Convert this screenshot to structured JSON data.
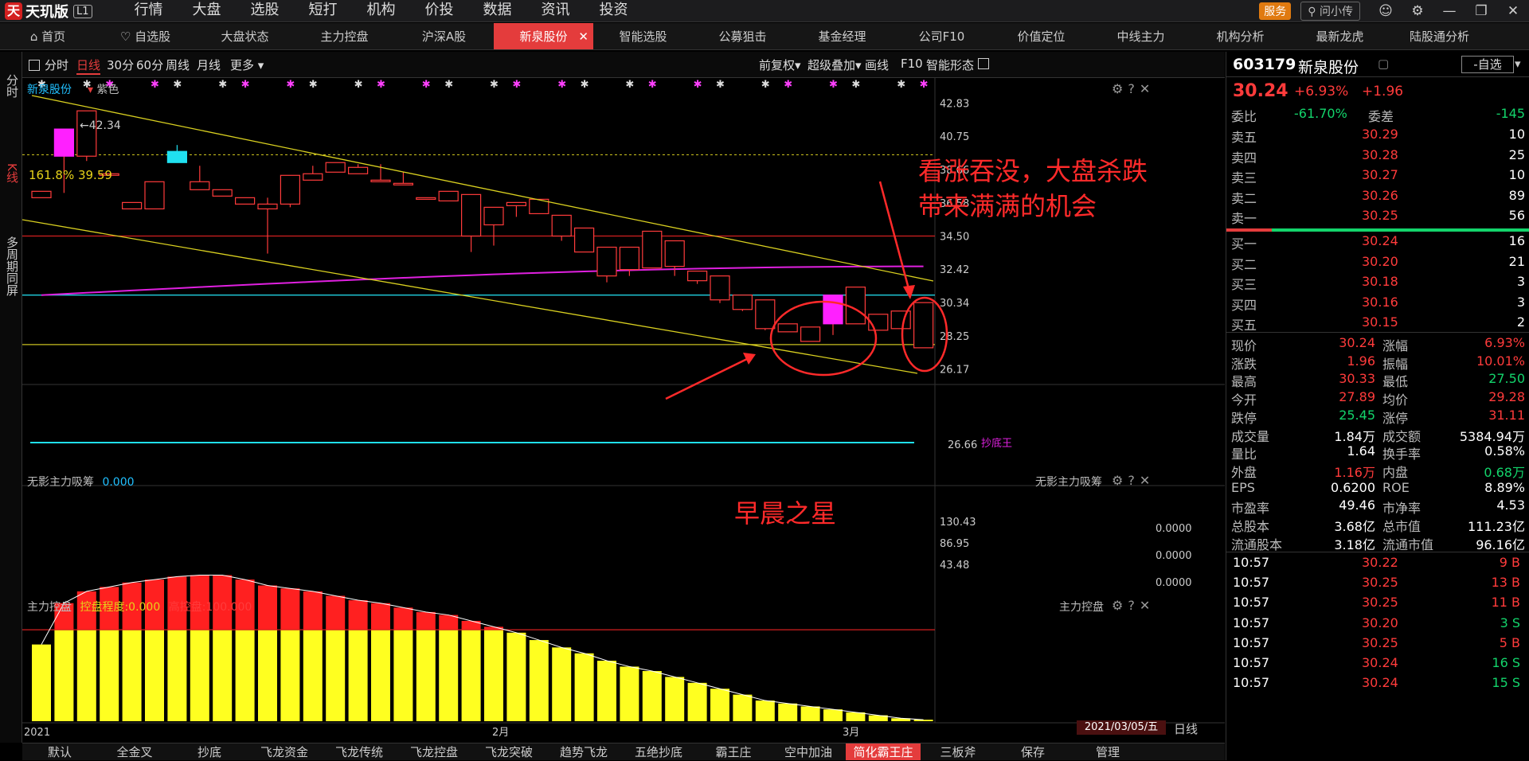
{
  "app": {
    "logo": "天玑版",
    "level": "L1",
    "service": "服务",
    "ask": "问小传"
  },
  "menu": [
    "行情",
    "大盘",
    "选股",
    "短打",
    "机构",
    "价投",
    "数据",
    "资讯",
    "投资"
  ],
  "tabs": [
    "首页",
    "自选股",
    "大盘状态",
    "主力控盘",
    "沪深A股",
    "新泉股份",
    "智能选股",
    "公募狙击",
    "基金经理",
    "公司F10",
    "价值定位",
    "中线主力",
    "机构分析",
    "最新龙虎",
    "陆股通分析"
  ],
  "left_tabs": [
    "分时",
    "K线",
    "多周期同屏"
  ],
  "periods": [
    "分时",
    "日线",
    "30分",
    "60分",
    "周线",
    "月线",
    "更多"
  ],
  "toolbar_right": [
    "前复权",
    "超级叠加",
    "画线",
    "F10",
    "智能形态"
  ],
  "stock": {
    "code": "603179",
    "name": "新泉股份",
    "add": "-自选",
    "price": "30.24",
    "pct": "+6.93%",
    "chg": "+1.96"
  },
  "main_title": {
    "name": "新泉股份",
    "indicator": "紫色"
  },
  "chart_data": {
    "type": "candlestick",
    "title": "新泉股份",
    "x_labels": [
      "2021",
      "2月",
      "3月"
    ],
    "date_cursor": "2021/03/05/五",
    "y_ticks": [
      42.83,
      40.75,
      38.66,
      36.58,
      34.5,
      32.42,
      30.34,
      28.25,
      26.17
    ],
    "ylim": [
      25.6,
      43.3
    ],
    "high_label": "42.34",
    "low_label": "26.66",
    "fib_label": "161.8% 39.59",
    "bottom_tag": "抄底王",
    "candles": [
      [
        36.9,
        37.3,
        36.9,
        37.3
      ],
      [
        37.2,
        41.0,
        39.5,
        41.2
      ],
      [
        39.2,
        42.34,
        39.5,
        42.34
      ],
      [
        38.4,
        38.4,
        38.4,
        38.4
      ],
      [
        36.6,
        36.6,
        36.2,
        36.6
      ],
      [
        36.6,
        37.8,
        36.2,
        37.9
      ],
      [
        39.1,
        40.2,
        39.8,
        39.1
      ],
      [
        37.9,
        38.9,
        37.4,
        37.9
      ],
      [
        37.4,
        37.4,
        37.0,
        37.4
      ],
      [
        36.9,
        36.9,
        36.5,
        36.9
      ],
      [
        33.4,
        36.9,
        36.2,
        36.5
      ],
      [
        36.3,
        38.3,
        36.5,
        38.3
      ],
      [
        38.1,
        38.9,
        38.0,
        38.4
      ],
      [
        38.5,
        38.9,
        38.5,
        39.1
      ],
      [
        38.6,
        39.0,
        38.4,
        38.8
      ],
      [
        38.9,
        39.0,
        38.0,
        38.0
      ],
      [
        38.2,
        38.5,
        37.8,
        37.8
      ],
      [
        36.9,
        36.9,
        36.9,
        36.9
      ],
      [
        36.7,
        37.3,
        36.7,
        37.3
      ],
      [
        33.5,
        37.1,
        34.5,
        37.1
      ],
      [
        33.9,
        36.3,
        35.2,
        36.3
      ],
      [
        35.7,
        36.6,
        36.4,
        36.6
      ],
      [
        36.6,
        36.8,
        35.9,
        36.8
      ],
      [
        34.2,
        35.8,
        34.5,
        35.8
      ],
      [
        33.8,
        35.0,
        33.5,
        35.0
      ],
      [
        31.6,
        33.8,
        32.0,
        33.8
      ],
      [
        32.0,
        33.8,
        32.4,
        33.8
      ],
      [
        32.8,
        34.6,
        32.5,
        34.8
      ],
      [
        32.0,
        34.0,
        32.6,
        34.2
      ],
      [
        31.5,
        32.3,
        31.7,
        32.3
      ],
      [
        30.3,
        32.0,
        30.5,
        32.0
      ],
      [
        29.8,
        30.8,
        29.9,
        30.8
      ],
      [
        28.6,
        30.5,
        28.7,
        30.5
      ],
      [
        28.5,
        29.0,
        28.5,
        29.0
      ],
      [
        28.5,
        28.8,
        27.9,
        28.8
      ],
      [
        28.3,
        30.8,
        29.0,
        30.8
      ],
      [
        29.0,
        31.2,
        29.0,
        31.3
      ],
      [
        29.5,
        29.6,
        28.6,
        29.6
      ],
      [
        28.7,
        29.8,
        28.7,
        29.8
      ],
      [
        27.9,
        30.33,
        27.5,
        30.33
      ]
    ],
    "ma": {
      "color": "#e020e0",
      "start": 30.8,
      "end": 32.6
    },
    "hlines": [
      {
        "value": 34.5,
        "color": "#d42020"
      },
      {
        "value": 30.8,
        "color": "#20d0e0"
      },
      {
        "value": 27.7,
        "color": "#c9c020"
      }
    ],
    "sub1": {
      "name": "无影主力吸筹",
      "value": "0.000",
      "ticks": [
        "0.0000",
        "0.0000",
        "0.0000"
      ]
    },
    "sub2": {
      "name": "主力控盘",
      "degree_label": "控盘程度:0.000",
      "high_label": "高控盘:100.000",
      "ticks": [
        "130.43",
        "86.95",
        "43.48"
      ],
      "values": [
        52,
        80,
        88,
        91,
        94,
        96,
        98,
        99,
        99,
        96,
        92,
        90,
        88,
        85,
        82,
        80,
        77,
        74,
        72,
        68,
        64,
        60,
        55,
        50,
        46,
        41,
        37,
        34,
        30,
        26,
        22,
        18,
        14,
        12,
        10,
        8,
        6,
        4,
        2,
        1
      ]
    }
  },
  "annotations": {
    "text1": "看涨吞没，大盘杀跌",
    "text2": "带来满满的机会",
    "text3": "早晨之星"
  },
  "quote": {
    "ratio": {
      "label": "委比",
      "value": "-61.70%",
      "diff_label": "委差",
      "diff": "-145"
    },
    "asks": [
      {
        "label": "卖五",
        "price": "30.29",
        "vol": "10"
      },
      {
        "label": "卖四",
        "price": "30.28",
        "vol": "25"
      },
      {
        "label": "卖三",
        "price": "30.27",
        "vol": "10"
      },
      {
        "label": "卖二",
        "price": "30.26",
        "vol": "89"
      },
      {
        "label": "卖一",
        "price": "30.25",
        "vol": "56"
      }
    ],
    "bids": [
      {
        "label": "买一",
        "price": "30.24",
        "vol": "16"
      },
      {
        "label": "买二",
        "price": "30.20",
        "vol": "21"
      },
      {
        "label": "买三",
        "price": "30.18",
        "vol": "3"
      },
      {
        "label": "买四",
        "price": "30.16",
        "vol": "3"
      },
      {
        "label": "买五",
        "price": "30.15",
        "vol": "2"
      }
    ],
    "stats": [
      [
        "现价",
        "30.24",
        "涨幅",
        "6.93%"
      ],
      [
        "涨跌",
        "1.96",
        "振幅",
        "10.01%"
      ],
      [
        "最高",
        "30.33",
        "最低",
        "27.50"
      ],
      [
        "今开",
        "27.89",
        "均价",
        "29.28"
      ],
      [
        "跌停",
        "25.45",
        "涨停",
        "31.11"
      ],
      [
        "成交量",
        "1.84万",
        "成交额",
        "5384.94万"
      ],
      [
        "量比",
        "1.64",
        "换手率",
        "0.58%"
      ],
      [
        "外盘",
        "1.16万",
        "内盘",
        "0.68万"
      ],
      [
        "EPS",
        "0.6200",
        "ROE",
        "8.89%"
      ],
      [
        "市盈率",
        "49.46",
        "市净率",
        "4.53"
      ],
      [
        "总股本",
        "3.68亿",
        "总市值",
        "111.23亿"
      ],
      [
        "流通股本",
        "3.18亿",
        "流通市值",
        "96.16亿"
      ]
    ],
    "trades": [
      [
        "10:57",
        "30.22",
        "9 B"
      ],
      [
        "10:57",
        "30.25",
        "13 B"
      ],
      [
        "10:57",
        "30.25",
        "11 B"
      ],
      [
        "10:57",
        "30.20",
        "3 S"
      ],
      [
        "10:57",
        "30.25",
        "5 B"
      ],
      [
        "10:57",
        "30.24",
        "16 S"
      ],
      [
        "10:57",
        "30.24",
        "15 S"
      ]
    ]
  },
  "bottom_tabs": [
    "默认",
    "全金叉",
    "抄底",
    "飞龙资金",
    "飞龙传统",
    "飞龙控盘",
    "飞龙突破",
    "趋势飞龙",
    "五绝抄底",
    "霸王庄",
    "空中加油",
    "简化霸王庄",
    "三板斧",
    "保存",
    "管理"
  ],
  "period_tag": "日线"
}
